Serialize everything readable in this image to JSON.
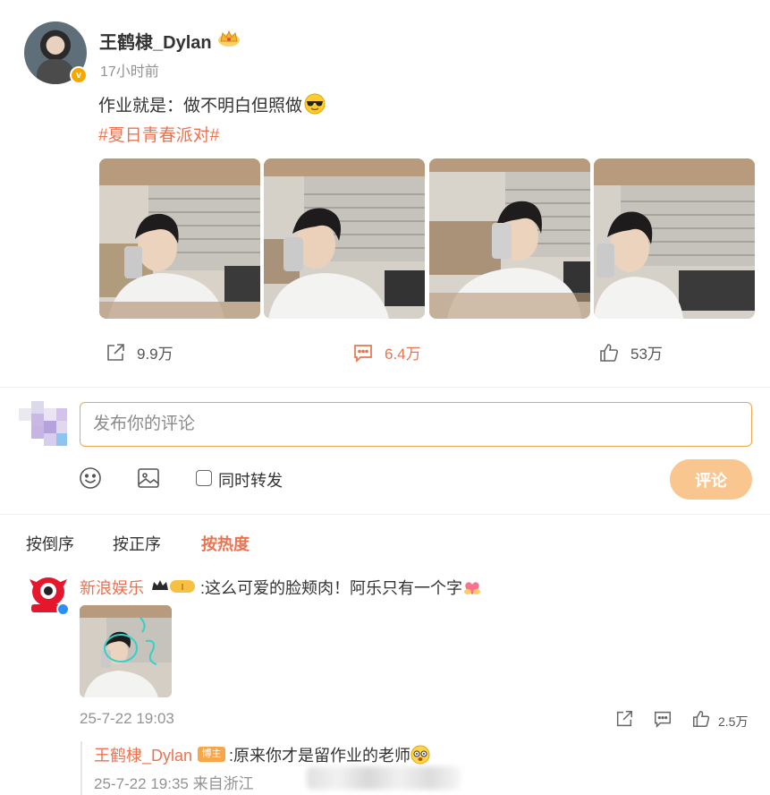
{
  "post": {
    "author": "王鹤棣_Dylan",
    "time": "17小时前",
    "text": "作业就是：做不明白但照做",
    "emoji": "sunglasses-emoji",
    "tag": "#夏日青春派对#",
    "photo_count": 4
  },
  "actions": {
    "repost_count": "9.9万",
    "comment_count": "6.4万",
    "like_count": "53万"
  },
  "composer": {
    "placeholder": "发布你的评论",
    "repost_label": "同时转发",
    "submit_label": "评论"
  },
  "sort": {
    "options": [
      "按倒序",
      "按正序",
      "按热度"
    ],
    "active": "按热度"
  },
  "comment": {
    "author": "新浪娱乐",
    "text": ":这么可爱的脸颊肉！阿乐只有一个字",
    "emoji": "heart-hands-emoji",
    "time": "25-7-22 19:03",
    "like_count": "2.5万"
  },
  "reply": {
    "author": "王鹤棣_Dylan",
    "badge": "博主",
    "text": ":原来你才是留作业的老师",
    "emoji": "dizzy-face-emoji",
    "time": "25-7-22 19:35 来自浙江"
  },
  "colors": {
    "accent": "#eb7350",
    "input_border": "#f0a64c",
    "submit_bg": "#f9c690",
    "muted_text": "#939393"
  }
}
